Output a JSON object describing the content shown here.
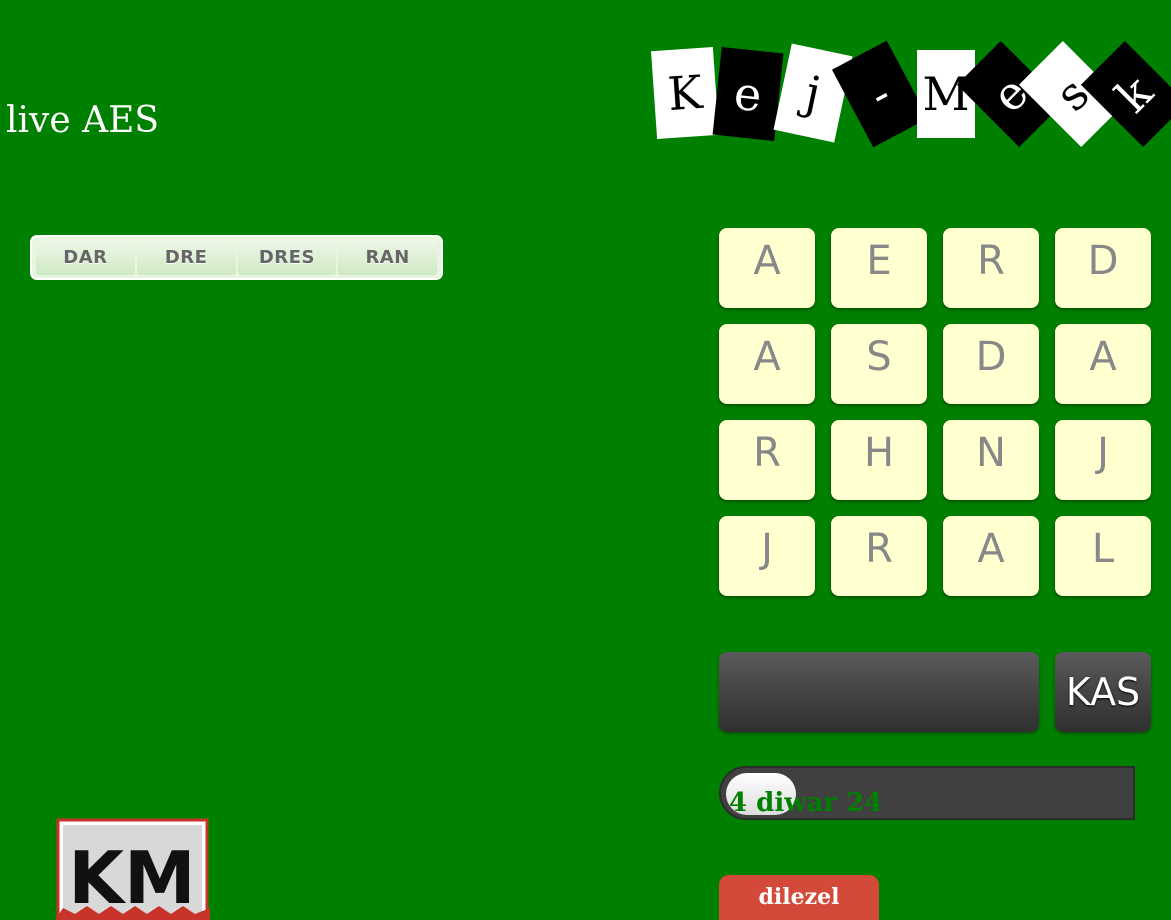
{
  "status": {
    "text": "live AES"
  },
  "logo": {
    "letters": [
      "K",
      "e",
      "j",
      "-",
      "M",
      "e",
      "s",
      "k"
    ]
  },
  "found_words": [
    "DAR",
    "DRE",
    "DRES",
    "RAN"
  ],
  "board": {
    "rows": [
      [
        "A",
        "E",
        "R",
        "D"
      ],
      [
        "A",
        "S",
        "D",
        "A"
      ],
      [
        "R",
        "H",
        "N",
        "J"
      ],
      [
        "J",
        "R",
        "A",
        "L"
      ]
    ]
  },
  "current_word": "",
  "submit": {
    "label": "KAS"
  },
  "progress": {
    "label": "4 diwar 24",
    "found": 4,
    "total": 24
  },
  "dilezel": {
    "label": "dilezel"
  },
  "badge": {
    "letters": "KM"
  },
  "colors": {
    "background": "#008000",
    "tile": "#ffffd0",
    "button": "#d44a3a"
  }
}
